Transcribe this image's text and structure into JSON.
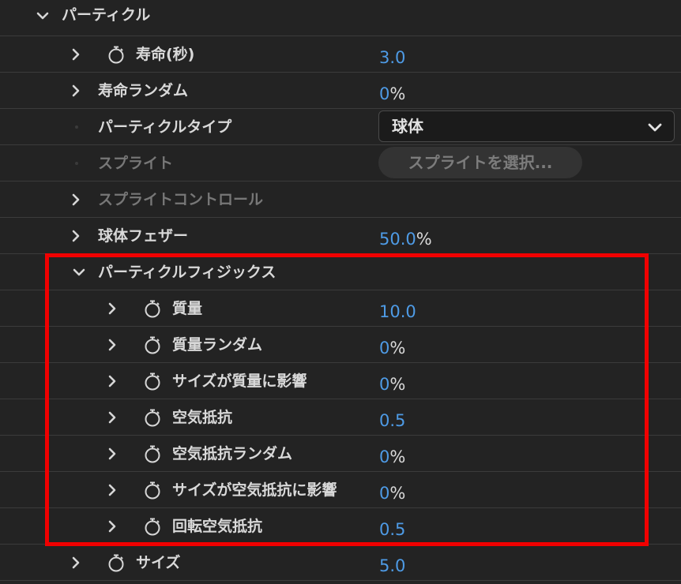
{
  "section": {
    "label": "パーティクル"
  },
  "rows": [
    {
      "label": "寿命(秒)",
      "value": "3.0",
      "unit": ""
    },
    {
      "label": "寿命ランダム",
      "value": "0",
      "unit": "%"
    },
    {
      "label": "パーティクルタイプ",
      "select_value": "球体"
    },
    {
      "label": "スプライト",
      "button_label": "スプライトを選択..."
    },
    {
      "label": "スプライトコントロール"
    },
    {
      "label": "球体フェザー",
      "value": "50.0",
      "unit": "%"
    },
    {
      "label": "パーティクルフィジックス"
    },
    {
      "label": "質量",
      "value": "10.0",
      "unit": ""
    },
    {
      "label": "質量ランダム",
      "value": "0",
      "unit": "%"
    },
    {
      "label": "サイズが質量に影響",
      "value": "0",
      "unit": "%"
    },
    {
      "label": "空気抵抗",
      "value": "0.5",
      "unit": ""
    },
    {
      "label": "空気抵抗ランダム",
      "value": "0",
      "unit": "%"
    },
    {
      "label": "サイズが空気抵抗に影響",
      "value": "0",
      "unit": "%"
    },
    {
      "label": "回転空気抵抗",
      "value": "0.5",
      "unit": ""
    },
    {
      "label": "サイズ",
      "value": "5.0",
      "unit": ""
    }
  ],
  "colors": {
    "background": "#232323",
    "value_blue": "#4e9be6",
    "highlight_red": "#f00000"
  },
  "icons": {
    "expand": "chevron-right-icon",
    "collapse": "chevron-down-icon",
    "keyframe": "stopwatch-icon"
  }
}
